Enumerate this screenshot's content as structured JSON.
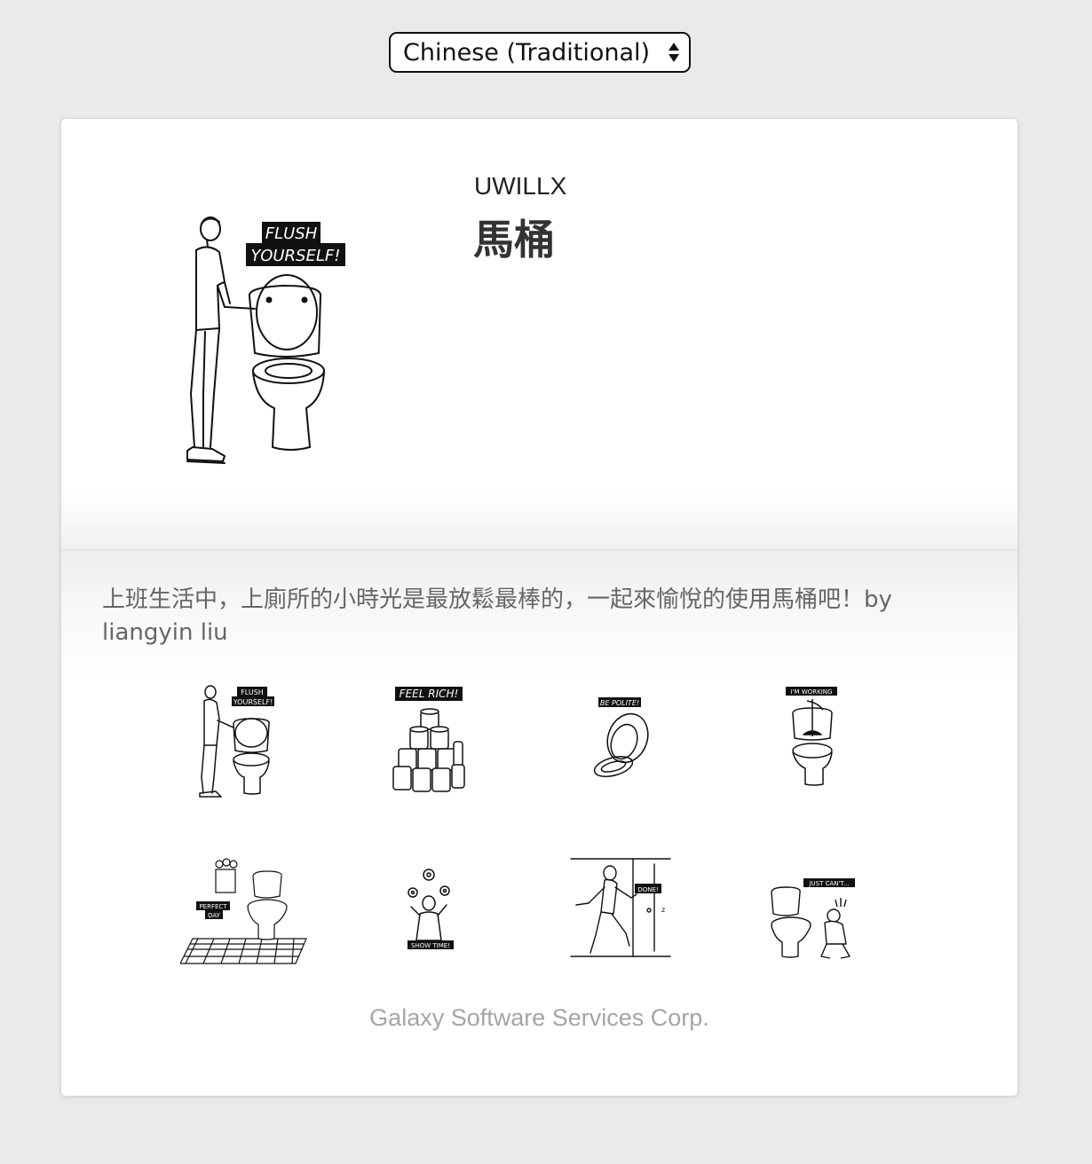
{
  "language_select": {
    "selected": "Chinese (Traditional)",
    "icon": "up-down-arrows-icon"
  },
  "sticker_pack": {
    "author": "UWILLX",
    "title": "馬桶",
    "hero_caption_line1": "FLUSH",
    "hero_caption_line2": "YOURSELF!",
    "description": "上班生活中，上廁所的小時光是最放鬆最棒的，一起來愉悅的使用馬桶吧！by liangyin liu"
  },
  "stickers": [
    {
      "caption": "FLUSH YOURSELF!",
      "caption_line1": "FLUSH",
      "caption_line2": "YOURSELF!"
    },
    {
      "caption": "FEEL RICH!"
    },
    {
      "caption": "BE POLITE!"
    },
    {
      "caption": "I'M WORKING"
    },
    {
      "caption": "PERFECT DAY",
      "caption_line1": "PERFECT",
      "caption_line2": "DAY"
    },
    {
      "caption": "SHOW TIME!"
    },
    {
      "caption": "DONE!"
    },
    {
      "caption": "JUST CAN'T..."
    }
  ],
  "footer": {
    "company": "Galaxy Software Services Corp."
  },
  "colors": {
    "page_background": "#e9eaea",
    "card_background": "#ffffff",
    "description_text": "#666666",
    "footer_text": "#a5a5a5",
    "caption_label_bg": "#111111"
  }
}
